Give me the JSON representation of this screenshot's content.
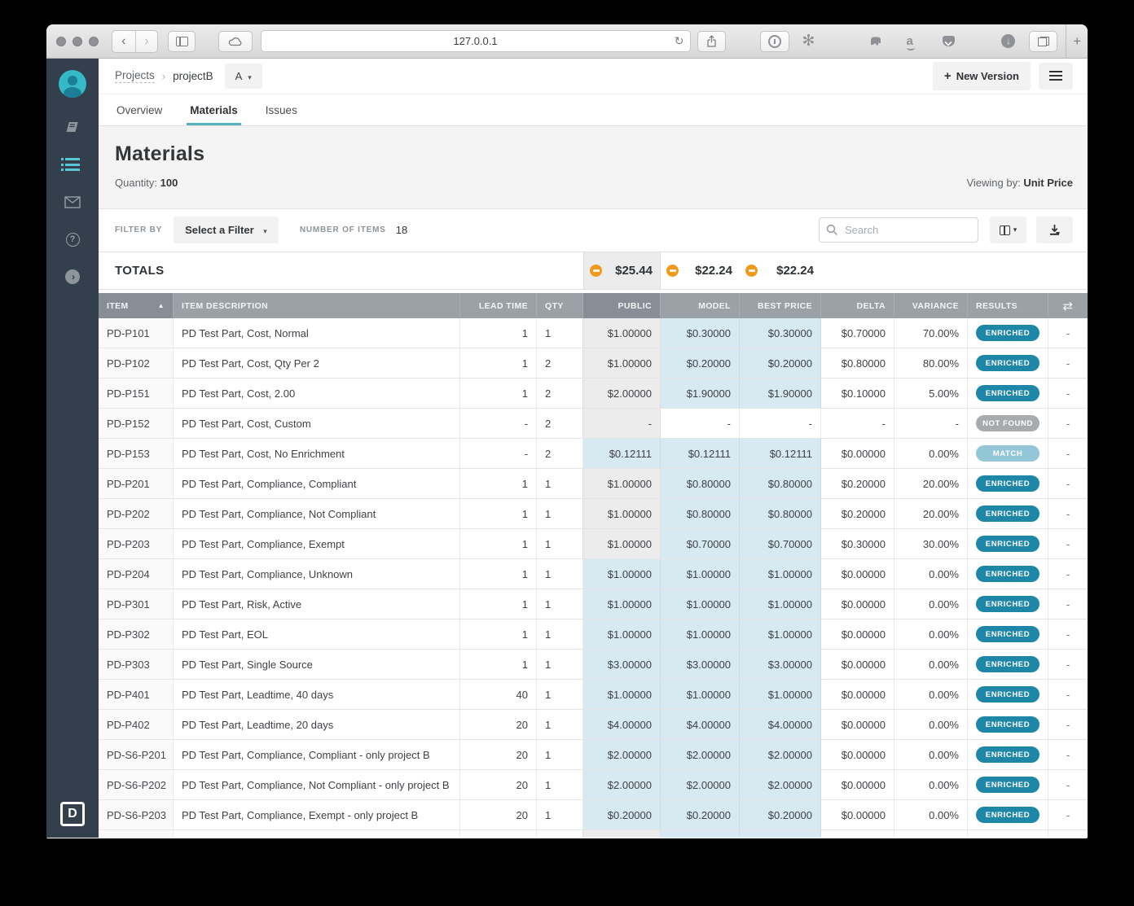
{
  "browser": {
    "url": "127.0.0.1",
    "back": "‹",
    "forward": "›",
    "reload": "↻",
    "extension_asterisk": "✻",
    "amazon": "a",
    "download_arrow": "↓",
    "new_tab": "+"
  },
  "sidebar": {
    "logo": "D",
    "expand_chevron": "›",
    "help_glyph": "?"
  },
  "breadcrumb": {
    "root": "Projects",
    "separator": "›",
    "current": "projectB",
    "version": "A",
    "caret": "▾"
  },
  "actions": {
    "plus": "+",
    "new_version": "New Version"
  },
  "tabs": [
    {
      "label": "Overview"
    },
    {
      "label": "Materials"
    },
    {
      "label": "Issues"
    }
  ],
  "hero": {
    "title": "Materials",
    "quantity_label": "Quantity:",
    "quantity_value": "100",
    "viewing_label": "Viewing by:",
    "viewing_value": "Unit Price"
  },
  "filterbar": {
    "filter_by": "FILTER BY",
    "filter_selected": "Select a Filter",
    "caret": "▾",
    "number_of_items": "NUMBER OF ITEMS",
    "count": "18",
    "search_placeholder": "Search"
  },
  "totals": {
    "label": "TOTALS",
    "public": "$25.44",
    "model": "$22.24",
    "best": "$22.24"
  },
  "table": {
    "headers": {
      "item": "ITEM",
      "description": "ITEM DESCRIPTION",
      "lead": "LEAD TIME",
      "qty": "QTY",
      "public": "PUBLIC",
      "model": "MODEL",
      "best": "BEST PRICE",
      "delta": "DELTA",
      "variance": "VARIANCE",
      "results": "RESULTS",
      "compare": "⇄",
      "sort": "▲"
    },
    "rows": [
      {
        "item": "PD-P101",
        "description": "PD Test Part, Cost, Normal",
        "lead": "1",
        "qty": "1",
        "public": "$1.00000",
        "model": "$0.30000",
        "best": "$0.30000",
        "delta": "$0.70000",
        "variance": "70.00%",
        "result": "ENRICHED",
        "result_type": "enriched",
        "public_state": "gray",
        "model_state": "blue",
        "compare": "-"
      },
      {
        "item": "PD-P102",
        "description": "PD Test Part, Cost, Qty Per 2",
        "lead": "1",
        "qty": "2",
        "public": "$1.00000",
        "model": "$0.20000",
        "best": "$0.20000",
        "delta": "$0.80000",
        "variance": "80.00%",
        "result": "ENRICHED",
        "result_type": "enriched",
        "public_state": "gray",
        "model_state": "blue",
        "compare": "-"
      },
      {
        "item": "PD-P151",
        "description": "PD Test Part, Cost, 2.00",
        "lead": "1",
        "qty": "2",
        "public": "$2.00000",
        "model": "$1.90000",
        "best": "$1.90000",
        "delta": "$0.10000",
        "variance": "5.00%",
        "result": "ENRICHED",
        "result_type": "enriched",
        "public_state": "gray",
        "model_state": "blue",
        "compare": "-"
      },
      {
        "item": "PD-P152",
        "description": "PD Test Part, Cost, Custom",
        "lead": "-",
        "qty": "2",
        "public": "-",
        "model": "-",
        "best": "-",
        "delta": "-",
        "variance": "-",
        "result": "NOT FOUND",
        "result_type": "notfound",
        "public_state": "gray",
        "model_state": "white",
        "compare": "-"
      },
      {
        "item": "PD-P153",
        "description": "PD Test Part, Cost, No Enrichment",
        "lead": "-",
        "qty": "2",
        "public": "$0.12111",
        "model": "$0.12111",
        "best": "$0.12111",
        "delta": "$0.00000",
        "variance": "0.00%",
        "result": "MATCH",
        "result_type": "match",
        "public_state": "blue",
        "model_state": "blue",
        "compare": "-"
      },
      {
        "item": "PD-P201",
        "description": "PD Test Part, Compliance, Compliant",
        "lead": "1",
        "qty": "1",
        "public": "$1.00000",
        "model": "$0.80000",
        "best": "$0.80000",
        "delta": "$0.20000",
        "variance": "20.00%",
        "result": "ENRICHED",
        "result_type": "enriched",
        "public_state": "gray",
        "model_state": "blue",
        "compare": "-"
      },
      {
        "item": "PD-P202",
        "description": "PD Test Part, Compliance, Not Compliant",
        "lead": "1",
        "qty": "1",
        "public": "$1.00000",
        "model": "$0.80000",
        "best": "$0.80000",
        "delta": "$0.20000",
        "variance": "20.00%",
        "result": "ENRICHED",
        "result_type": "enriched",
        "public_state": "gray",
        "model_state": "blue",
        "compare": "-"
      },
      {
        "item": "PD-P203",
        "description": "PD Test Part, Compliance, Exempt",
        "lead": "1",
        "qty": "1",
        "public": "$1.00000",
        "model": "$0.70000",
        "best": "$0.70000",
        "delta": "$0.30000",
        "variance": "30.00%",
        "result": "ENRICHED",
        "result_type": "enriched",
        "public_state": "gray",
        "model_state": "blue",
        "compare": "-"
      },
      {
        "item": "PD-P204",
        "description": "PD Test Part, Compliance, Unknown",
        "lead": "1",
        "qty": "1",
        "public": "$1.00000",
        "model": "$1.00000",
        "best": "$1.00000",
        "delta": "$0.00000",
        "variance": "0.00%",
        "result": "ENRICHED",
        "result_type": "enriched",
        "public_state": "blue",
        "model_state": "blue",
        "compare": "-"
      },
      {
        "item": "PD-P301",
        "description": "PD Test Part, Risk, Active",
        "lead": "1",
        "qty": "1",
        "public": "$1.00000",
        "model": "$1.00000",
        "best": "$1.00000",
        "delta": "$0.00000",
        "variance": "0.00%",
        "result": "ENRICHED",
        "result_type": "enriched",
        "public_state": "blue",
        "model_state": "blue",
        "compare": "-"
      },
      {
        "item": "PD-P302",
        "description": "PD Test Part, EOL",
        "lead": "1",
        "qty": "1",
        "public": "$1.00000",
        "model": "$1.00000",
        "best": "$1.00000",
        "delta": "$0.00000",
        "variance": "0.00%",
        "result": "ENRICHED",
        "result_type": "enriched",
        "public_state": "blue",
        "model_state": "blue",
        "compare": "-"
      },
      {
        "item": "PD-P303",
        "description": "PD Test Part, Single Source",
        "lead": "1",
        "qty": "1",
        "public": "$3.00000",
        "model": "$3.00000",
        "best": "$3.00000",
        "delta": "$0.00000",
        "variance": "0.00%",
        "result": "ENRICHED",
        "result_type": "enriched",
        "public_state": "blue",
        "model_state": "blue",
        "compare": "-"
      },
      {
        "item": "PD-P401",
        "description": "PD Test Part, Leadtime, 40 days",
        "lead": "40",
        "qty": "1",
        "public": "$1.00000",
        "model": "$1.00000",
        "best": "$1.00000",
        "delta": "$0.00000",
        "variance": "0.00%",
        "result": "ENRICHED",
        "result_type": "enriched",
        "public_state": "blue",
        "model_state": "blue",
        "compare": "-"
      },
      {
        "item": "PD-P402",
        "description": "PD Test Part, Leadtime, 20 days",
        "lead": "20",
        "qty": "1",
        "public": "$4.00000",
        "model": "$4.00000",
        "best": "$4.00000",
        "delta": "$0.00000",
        "variance": "0.00%",
        "result": "ENRICHED",
        "result_type": "enriched",
        "public_state": "blue",
        "model_state": "blue",
        "compare": "-"
      },
      {
        "item": "PD-S6-P201",
        "description": "PD Test Part, Compliance, Compliant - only project B",
        "lead": "20",
        "qty": "1",
        "public": "$2.00000",
        "model": "$2.00000",
        "best": "$2.00000",
        "delta": "$0.00000",
        "variance": "0.00%",
        "result": "ENRICHED",
        "result_type": "enriched",
        "public_state": "blue",
        "model_state": "blue",
        "compare": "-"
      },
      {
        "item": "PD-S6-P202",
        "description": "PD Test Part, Compliance, Not Compliant - only project B",
        "lead": "20",
        "qty": "1",
        "public": "$2.00000",
        "model": "$2.00000",
        "best": "$2.00000",
        "delta": "$0.00000",
        "variance": "0.00%",
        "result": "ENRICHED",
        "result_type": "enriched",
        "public_state": "blue",
        "model_state": "blue",
        "compare": "-"
      },
      {
        "item": "PD-S6-P203",
        "description": "PD Test Part, Compliance, Exempt - only project B",
        "lead": "20",
        "qty": "1",
        "public": "$0.20000",
        "model": "$0.20000",
        "best": "$0.20000",
        "delta": "$0.00000",
        "variance": "0.00%",
        "result": "ENRICHED",
        "result_type": "enriched",
        "public_state": "blue",
        "model_state": "blue",
        "compare": "-"
      }
    ]
  },
  "colors": {
    "accent_teal": "#57b2c0",
    "badge_enriched": "#1e87a8",
    "badge_match": "#93c7d8",
    "badge_not_found": "#a8abae",
    "warning_orange": "#f09a1c",
    "table_header_gray": "#9aa1a7",
    "table_header_dark": "#878e95",
    "cell_blue": "#d7e9f1",
    "cell_gray": "#ececec",
    "sidebar_bg": "#333f4c"
  }
}
